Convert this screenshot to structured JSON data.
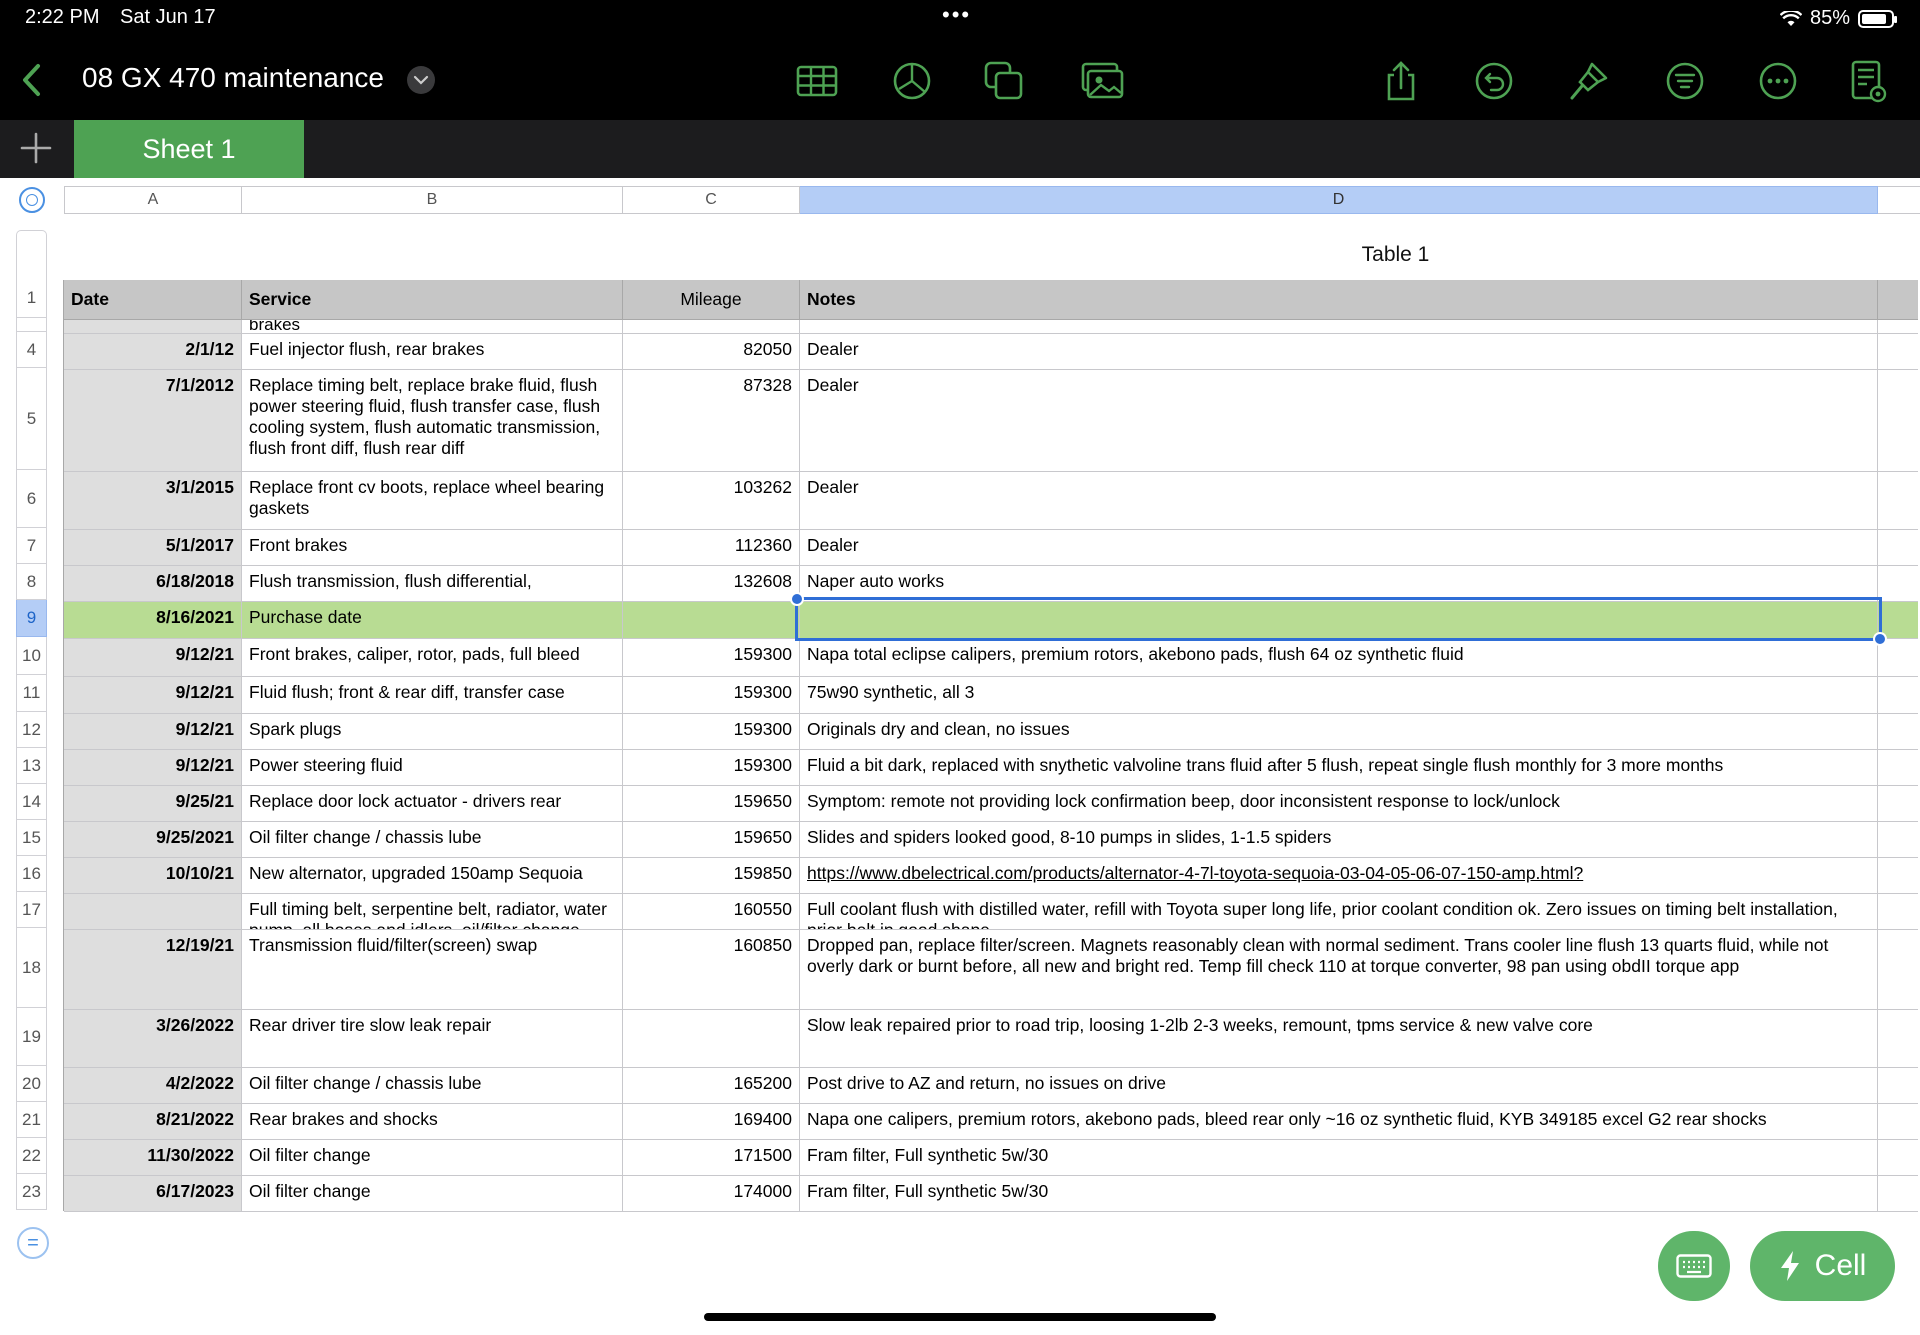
{
  "status_bar": {
    "time": "2:22 PM",
    "date": "Sat Jun 17",
    "dots": "•••",
    "battery": "85%",
    "battery_level": 0.85
  },
  "toolbar": {
    "title": "08 GX 470 maintenance",
    "accent_color": "#4ea253",
    "icons": [
      "table-icon",
      "chart-icon",
      "shape-icon",
      "media-icon",
      "share-icon",
      "undo-icon",
      "format-brush-icon",
      "organize-icon",
      "more-icon",
      "reader-view-icon"
    ]
  },
  "sheet_tabs": [
    "Sheet 1"
  ],
  "column_headers": [
    "A",
    "B",
    "C",
    "D"
  ],
  "table": {
    "title": "Table 1",
    "headers": {
      "date": "Date",
      "service": "Service",
      "mileage": "Mileage",
      "notes": "Notes"
    },
    "partial_row_text": "brakes",
    "rows": [
      {
        "num": "4",
        "date": "2/1/12",
        "service": "Fuel injector flush, rear brakes",
        "mileage": "82050",
        "notes": "Dealer"
      },
      {
        "num": "5",
        "date": "7/1/2012",
        "service": "Replace timing belt, replace brake fluid, flush power steering fluid, flush transfer case, flush cooling system, flush automatic transmission, flush front diff, flush rear diff",
        "mileage": "87328",
        "notes": "Dealer"
      },
      {
        "num": "6",
        "date": "3/1/2015",
        "service": "Replace front cv boots, replace wheel bearing gaskets",
        "mileage": "103262",
        "notes": "Dealer"
      },
      {
        "num": "7",
        "date": "5/1/2017",
        "service": "Front brakes",
        "mileage": "112360",
        "notes": "Dealer"
      },
      {
        "num": "8",
        "date": "6/18/2018",
        "service": "Flush transmission, flush differential,",
        "mileage": "132608",
        "notes": "Naper auto works"
      },
      {
        "num": "9",
        "date": "8/16/2021",
        "service": "Purchase date",
        "mileage": "",
        "notes": ""
      },
      {
        "num": "10",
        "date": "9/12/21",
        "service": "Front brakes, caliper, rotor, pads, full bleed",
        "mileage": "159300",
        "notes": "Napa total eclipse calipers, premium rotors, akebono pads, flush 64 oz synthetic fluid"
      },
      {
        "num": "11",
        "date": "9/12/21",
        "service": "Fluid flush; front & rear diff, transfer case",
        "mileage": "159300",
        "notes": "75w90 synthetic, all 3"
      },
      {
        "num": "12",
        "date": "9/12/21",
        "service": "Spark plugs",
        "mileage": "159300",
        "notes": "Originals dry and clean, no issues"
      },
      {
        "num": "13",
        "date": "9/12/21",
        "service": "Power steering fluid",
        "mileage": "159300",
        "notes": "Fluid a bit dark, replaced with snythetic valvoline trans fluid after 5 flush, repeat single flush monthly for 3 more months"
      },
      {
        "num": "14",
        "date": "9/25/21",
        "service": "Replace door lock actuator - drivers rear",
        "mileage": "159650",
        "notes": "Symptom: remote not providing lock confirmation beep, door inconsistent response to lock/unlock"
      },
      {
        "num": "15",
        "date": "9/25/2021",
        "service": "Oil filter change / chassis lube",
        "mileage": "159650",
        "notes": "Slides and spiders looked good, 8-10 pumps in slides, 1-1.5 spiders"
      },
      {
        "num": "16",
        "date": "10/10/21",
        "service": "New alternator, upgraded 150amp Sequoia",
        "mileage": "159850",
        "notes": "https://www.dbelectrical.com/products/alternator-4-7l-toyota-sequoia-03-04-05-06-07-150-amp.html?"
      },
      {
        "num": "17",
        "date": "",
        "service": "Full timing belt, serpentine belt, radiator, water pump, all hoses and idlers, oil/filter change",
        "mileage": "160550",
        "notes": "Full coolant flush with distilled water, refill with Toyota super long life, prior coolant condition ok. Zero issues on timing belt installation, prior belt in good shape."
      },
      {
        "num": "18",
        "date": "12/19/21",
        "service": "Transmission fluid/filter(screen) swap",
        "mileage": "160850",
        "notes": "Dropped pan, replace filter/screen. Magnets reasonably clean with normal sediment. Trans cooler line flush 13 quarts fluid, while not overly dark or burnt before, all new and bright red. Temp fill check 110 at torque converter, 98 pan using obdII torque app"
      },
      {
        "num": "19",
        "date": "3/26/2022",
        "service": "Rear driver tire slow leak repair",
        "mileage": "",
        "notes": "Slow leak repaired prior to road trip, loosing 1-2lb 2-3 weeks, remount, tpms service & new valve core"
      },
      {
        "num": "20",
        "date": "4/2/2022",
        "service": "Oil filter change / chassis lube",
        "mileage": "165200",
        "notes": "Post drive to AZ and return, no issues on drive"
      },
      {
        "num": "21",
        "date": "8/21/2022",
        "service": "Rear brakes and shocks",
        "mileage": "169400",
        "notes": "Napa one calipers, premium rotors, akebono pads, bleed rear only ~16 oz synthetic fluid, KYB 349185 excel G2 rear shocks"
      },
      {
        "num": "22",
        "date": "11/30/2022",
        "service": "Oil filter change",
        "mileage": "171500",
        "notes": "Fram filter, Full synthetic 5w/30"
      },
      {
        "num": "23",
        "date": "6/17/2023",
        "service": "Oil filter change",
        "mileage": "174000",
        "notes": "Fram filter, Full synthetic 5w/30"
      }
    ]
  },
  "header_row_num": "1",
  "selected_row": "9",
  "selected_column": "D",
  "colors": {
    "header_bg": "#c6c6c6",
    "highlight_row": "#b8dc93",
    "selection": "#2f6ed6",
    "button_green": "#5fb56a"
  },
  "bottom_buttons": {
    "keyboard_icon": "keyboard-icon",
    "cell_label": "Cell"
  }
}
